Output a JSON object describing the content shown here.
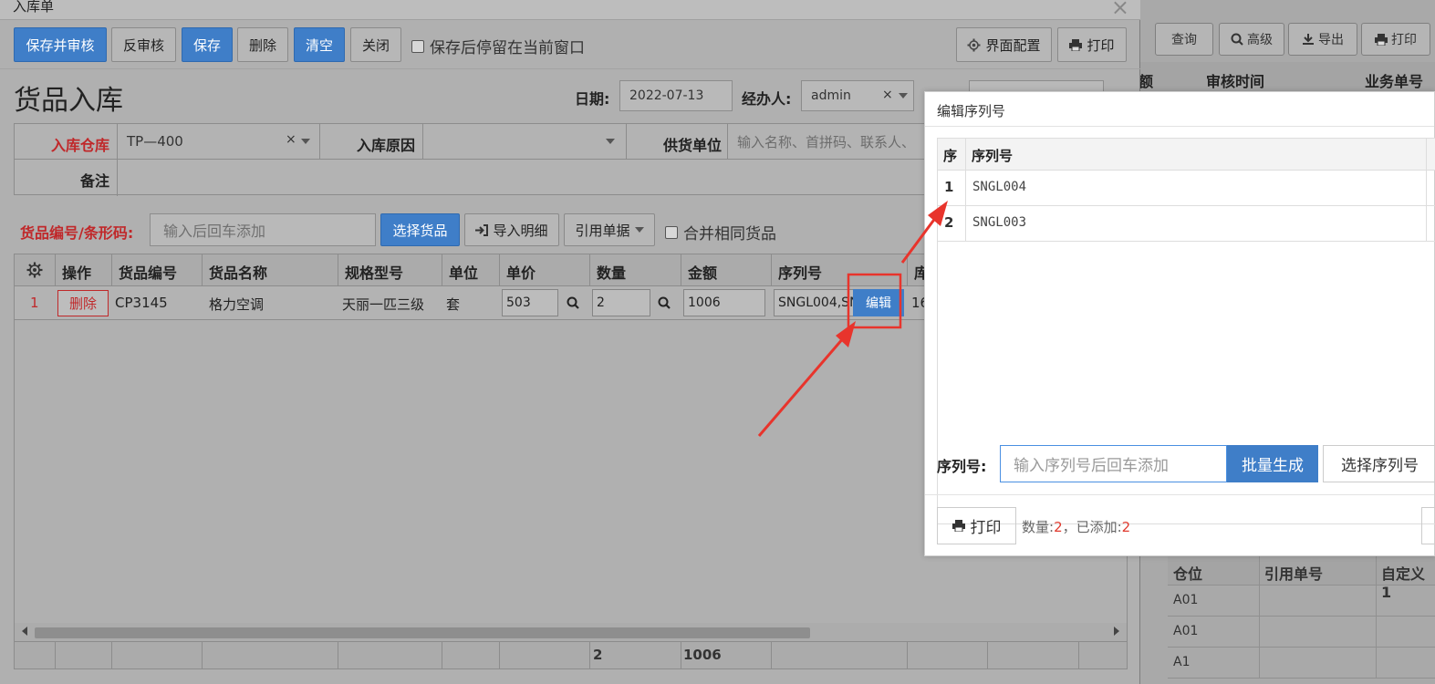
{
  "background": {
    "toolbar": [
      {
        "label": "查询",
        "icon": ""
      },
      {
        "label": "高级",
        "icon": "search-icon"
      },
      {
        "label": "导出",
        "icon": "download-icon"
      },
      {
        "label": "打印",
        "icon": "print-icon"
      }
    ],
    "header": [
      "审核时间",
      "业务单号"
    ],
    "header_partial": "额",
    "grid2_header": [
      "仓位",
      "引用单号",
      "自定义1"
    ],
    "grid2_rows": [
      "A01",
      "A01",
      "A1"
    ]
  },
  "dialog": {
    "title": "入库单",
    "close": "×",
    "toolbar": {
      "save_audit": "保存并审核",
      "unaudit": "反审核",
      "save": "保存",
      "delete": "删除",
      "clear": "清空",
      "close": "关闭",
      "stay_checkbox": "保存后停留在当前窗口",
      "ui_config": "界面配置",
      "print": "打印"
    },
    "page_title": "货品入库",
    "date_label": "日期:",
    "date_value": "2022-07-13",
    "handler_label": "经办人:",
    "handler_value": "admin",
    "form": {
      "warehouse_label": "入库仓库",
      "warehouse_value": "TP—400",
      "reason_label": "入库原因",
      "reason_value": "",
      "supplier_label": "供货单位",
      "supplier_placeholder": "输入名称、首拼码、联系人、",
      "remark_label": "备注"
    },
    "item_bar": {
      "code_label": "货品编号/条形码:",
      "code_placeholder": "输入后回车添加",
      "choose_goods": "选择货品",
      "import_detail": "导入明细",
      "cite_doc": "引用单据",
      "merge_checkbox": "合并相同货品"
    },
    "grid": {
      "columns": [
        "操作",
        "货品编号",
        "货品名称",
        "规格型号",
        "单位",
        "单价",
        "数量",
        "金额",
        "序列号",
        "库"
      ],
      "rows": [
        {
          "index": "1",
          "action": "删除",
          "code": "CP3145",
          "name": "格力空调",
          "spec": "天丽一匹三级",
          "unit": "套",
          "price": "503",
          "qty": "2",
          "amount": "1006",
          "serial": "SNGL004,SN",
          "serial_edit": "编辑",
          "stock": "16"
        }
      ],
      "footer": {
        "qty": "2",
        "amount": "1006"
      }
    }
  },
  "popup": {
    "title": "编辑序列号",
    "columns": [
      "序",
      "序列号"
    ],
    "rows": [
      {
        "n": "1",
        "serial": "SNGL004"
      },
      {
        "n": "2",
        "serial": "SNGL003"
      }
    ],
    "serial_label": "序列号:",
    "serial_placeholder": "输入序列号后回车添加",
    "batch_generate": "批量生成",
    "choose_serial": "选择序列号",
    "print": "打印",
    "count_label": "数量:",
    "count_value": "2",
    "added_label": "，已添加:",
    "added_value": "2"
  },
  "colors": {
    "primary_blue": "#3f7ec8",
    "required_red": "#c0282a",
    "annotation_red": "#e8342c"
  }
}
